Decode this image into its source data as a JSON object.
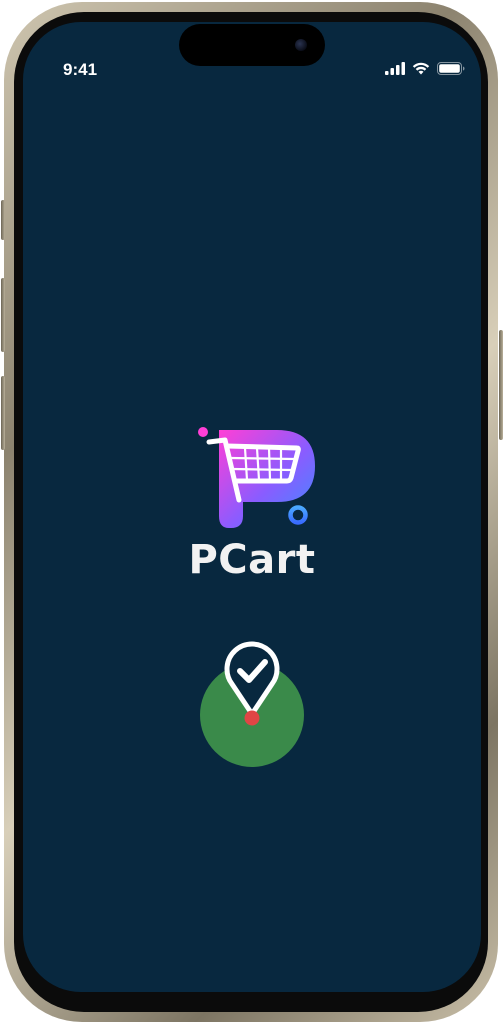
{
  "status_bar": {
    "time": "9:41",
    "icons": [
      "cellular-signal-icon",
      "wifi-icon",
      "battery-icon"
    ]
  },
  "splash": {
    "brand_name": "PCart",
    "logo_icon": "cart-logo-icon",
    "location_icon": "location-pin-check-icon"
  },
  "colors": {
    "background": "#08283f",
    "brand_text": "#f2f2f2",
    "circle": "#3a8a4a",
    "pin_dot": "#e04545",
    "logo_gradient_start": "#ff40d8",
    "logo_gradient_end": "#3a8cff"
  }
}
